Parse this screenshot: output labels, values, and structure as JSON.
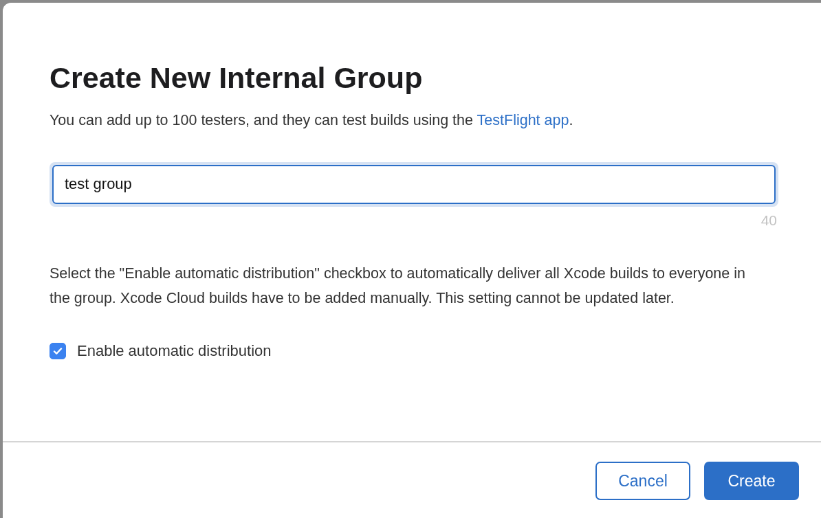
{
  "dialog": {
    "title": "Create New Internal Group",
    "intro": {
      "text": "You can add up to 100 testers, and they can test builds using the ",
      "link": "TestFlight app",
      "after": "."
    },
    "name_field": {
      "value": "test group",
      "counter": "40",
      "focused": true
    },
    "description": "Select the \"Enable automatic distribution\" checkbox to automatically deliver all Xcode builds to everyone in the group. Xcode Cloud builds have to be added manually. This setting cannot be updated later.",
    "checkbox": {
      "label": "Enable automatic distribution",
      "checked": true
    },
    "buttons": [
      {
        "label": "Cancel",
        "kind": "secondary"
      },
      {
        "label": "Create",
        "kind": "primary"
      }
    ]
  }
}
